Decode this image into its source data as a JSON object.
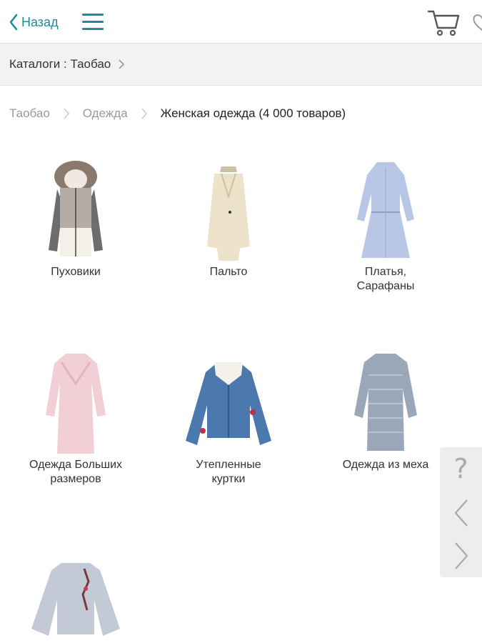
{
  "header": {
    "back_label": "Назад",
    "menu_icon": "hamburger-icon",
    "cart_icon": "cart-icon",
    "favorite_icon": "heart-icon",
    "accent_color": "#1f8a9a"
  },
  "catalog_bar": {
    "text": "Каталоги : Таобао"
  },
  "breadcrumb": {
    "items": [
      "Таобао",
      "Одежда"
    ],
    "current": "Женская одежда (4 000 товаров)"
  },
  "categories": [
    {
      "label": "Пуховики",
      "icon": "down-jacket-image"
    },
    {
      "label": "Пальто",
      "icon": "coat-image"
    },
    {
      "label": "Платья,\nСарафаны",
      "icon": "dress-image"
    },
    {
      "label": "Одежда Больших\nразмеров",
      "icon": "plus-size-dress-image"
    },
    {
      "label": "Утепленные\nкуртки",
      "icon": "denim-jacket-image"
    },
    {
      "label": "Одежда из меха",
      "icon": "fur-coat-image"
    },
    {
      "label": "",
      "icon": "blouse-image"
    }
  ],
  "side_widget": {
    "help_label": "?",
    "prev_icon": "chevron-left-icon",
    "next_icon": "chevron-right-icon"
  }
}
